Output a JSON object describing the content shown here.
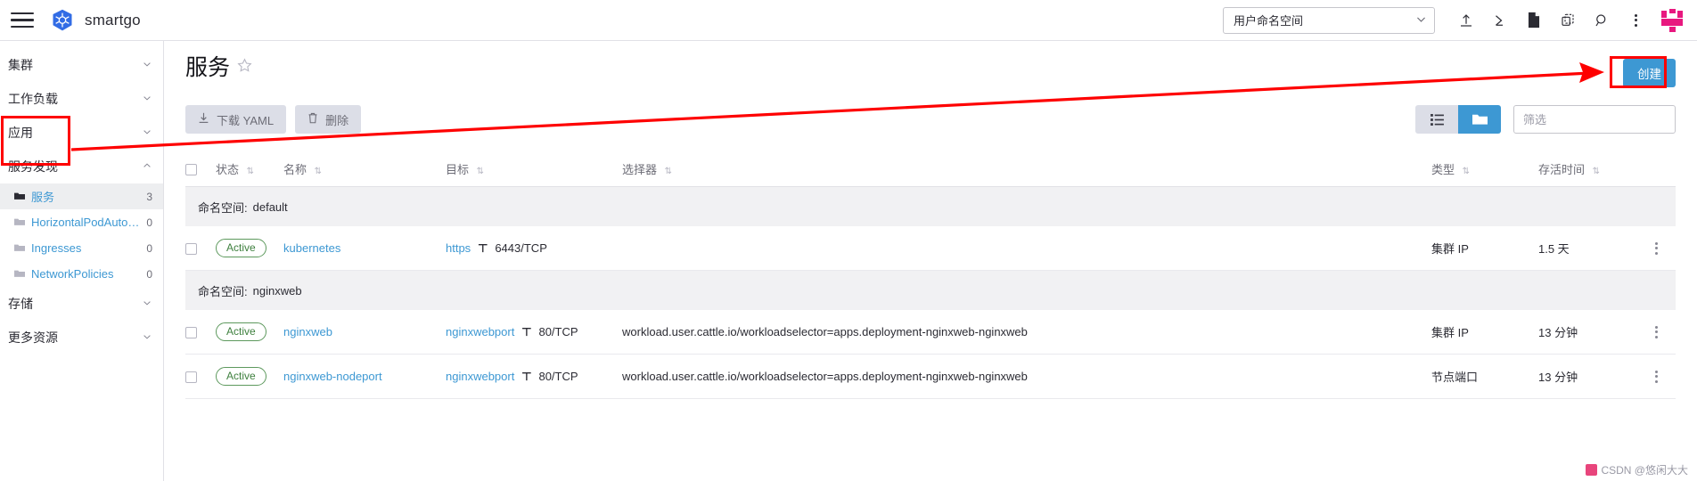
{
  "topbar": {
    "menu_icon": "hamburger-icon",
    "logo_icon": "kubernetes-logo-icon",
    "brand": "smartgo",
    "namespace_select": {
      "value": "用户命名空间",
      "caret": "chevron-down-icon"
    },
    "icons": [
      {
        "name": "import-yaml-icon",
        "glyph": "upload"
      },
      {
        "name": "kubectl-shell-icon",
        "glyph": "shell"
      },
      {
        "name": "docs-icon",
        "glyph": "file"
      },
      {
        "name": "copy-kubeconfig-icon",
        "glyph": "copy"
      },
      {
        "name": "search-icon",
        "glyph": "search"
      },
      {
        "name": "more-actions-icon",
        "glyph": "kebab"
      }
    ],
    "avatar": "user-avatar"
  },
  "sidebar": {
    "groups": [
      {
        "label": "集群",
        "chev": "⌄",
        "expanded": false
      },
      {
        "label": "工作负载",
        "chev": "⌄",
        "expanded": false
      },
      {
        "label": "应用",
        "chev": "⌄",
        "expanded": false
      },
      {
        "label": "服务发现",
        "chev": "⌃",
        "expanded": true
      },
      {
        "label": "存储",
        "chev": "⌄",
        "expanded": false
      },
      {
        "label": "更多资源",
        "chev": "⌄",
        "expanded": false
      }
    ],
    "service_discovery_children": [
      {
        "label": "服务",
        "count": "3",
        "active": true
      },
      {
        "label": "HorizontalPodAutoscalers",
        "count": "0",
        "active": false
      },
      {
        "label": "Ingresses",
        "count": "0",
        "active": false
      },
      {
        "label": "NetworkPolicies",
        "count": "0",
        "active": false
      }
    ]
  },
  "page": {
    "title": "服务",
    "favorite_icon": "star-icon",
    "create_label": "创建",
    "download_yaml_label": "下载 YAML",
    "delete_label": "删除",
    "download_icon": "download-icon",
    "trash_icon": "trash-icon",
    "view_list_icon": "list-view-icon",
    "view_group_icon": "group-view-icon",
    "filter_placeholder": "筛选",
    "filter_value": ""
  },
  "table": {
    "headers": {
      "status": "状态",
      "name": "名称",
      "target": "目标",
      "selector": "选择器",
      "type": "类型",
      "age": "存活时间"
    },
    "namespace_label": "命名空间:",
    "groups": [
      {
        "namespace": "default",
        "rows": [
          {
            "status": "Active",
            "name": "kubernetes",
            "target_link": "https",
            "target_rest": "6443/TCP",
            "selector": "",
            "type": "集群 IP",
            "age": "1.5 天"
          }
        ]
      },
      {
        "namespace": "nginxweb",
        "rows": [
          {
            "status": "Active",
            "name": "nginxweb",
            "target_link": "nginxwebport",
            "target_rest": "80/TCP",
            "selector": "workload.user.cattle.io/workloadselector=apps.deployment-nginxweb-nginxweb",
            "type": "集群 IP",
            "age": "13 分钟"
          },
          {
            "status": "Active",
            "name": "nginxweb-nodeport",
            "target_link": "nginxwebport",
            "target_rest": "80/TCP",
            "selector": "workload.user.cattle.io/workloadselector=apps.deployment-nginxweb-nginxweb",
            "type": "节点端口",
            "age": "13 分钟"
          }
        ]
      }
    ]
  },
  "annotations": {
    "color": "#fe0000",
    "box_sidebar": "highlight-service-discovery",
    "box_create": "highlight-create-button",
    "arrow": "arrow-from-sidebar-to-create-button"
  },
  "watermark": {
    "text": "CSDN @悠闲大大"
  },
  "colors": {
    "accent": "#3d98d3",
    "annotation": "#fe0000",
    "active_badge": "#3d7f3d",
    "group_band": "#f1f1f3"
  }
}
